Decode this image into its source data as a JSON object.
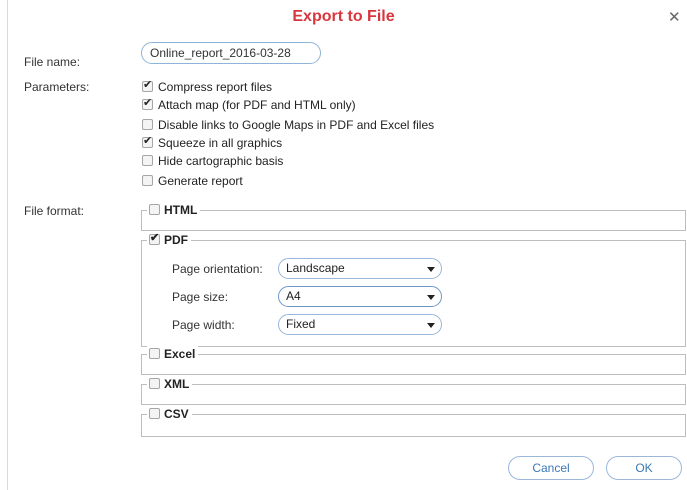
{
  "dialog": {
    "title": "Export to File",
    "close_icon": "close-icon",
    "accent_color": "#d9373f"
  },
  "labels": {
    "file_name": "File name:",
    "parameters": "Parameters:",
    "file_format": "File format:"
  },
  "file_name_value": "Online_report_2016-03-28",
  "parameters": [
    {
      "label": "Compress report files",
      "checked": true
    },
    {
      "label": "Attach map (for PDF and HTML only)",
      "checked": true
    },
    {
      "label": "Disable links to Google Maps in PDF and Excel files",
      "checked": false
    },
    {
      "label": "Squeeze in all graphics",
      "checked": true
    },
    {
      "label": "Hide cartographic basis",
      "checked": false
    },
    {
      "label": "Generate report",
      "checked": false
    }
  ],
  "formats": {
    "html": {
      "label": "HTML",
      "checked": false
    },
    "pdf": {
      "label": "PDF",
      "checked": true,
      "options": {
        "page_orientation": {
          "label": "Page orientation:",
          "value": "Landscape"
        },
        "page_size": {
          "label": "Page size:",
          "value": "A4"
        },
        "page_width": {
          "label": "Page width:",
          "value": "Fixed"
        }
      }
    },
    "excel": {
      "label": "Excel",
      "checked": false
    },
    "xml": {
      "label": "XML",
      "checked": false
    },
    "csv": {
      "label": "CSV",
      "checked": false
    }
  },
  "buttons": {
    "cancel": "Cancel",
    "ok": "OK"
  }
}
